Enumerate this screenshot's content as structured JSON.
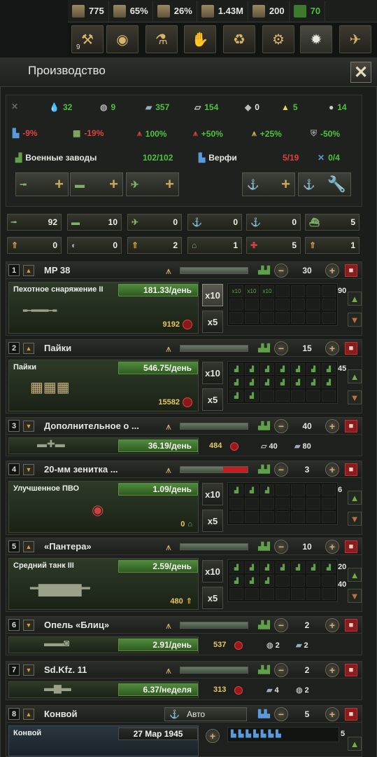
{
  "topbar": {
    "political_power": "775",
    "stability": "65%",
    "war_support": "26%",
    "manpower": "1.43M",
    "factories": "200",
    "convoys": "70"
  },
  "tabs": {
    "decisions_count": "9",
    "icons": [
      "hammer-icon",
      "eye-icon",
      "research-icon",
      "handshake-icon",
      "recycle-icon",
      "construction-icon",
      "gear-icon",
      "plane-icon"
    ]
  },
  "panel": {
    "title": "Производство",
    "close": "✕"
  },
  "resources": {
    "oil": "32",
    "rubber": "9",
    "steel": "357",
    "aluminium": "154",
    "tungsten": "0",
    "chromium": "5",
    "other": "14"
  },
  "modifiers": {
    "m1": "-9%",
    "m2": "-19%",
    "m3": "100%",
    "m4": "+50%",
    "m5": "+25%",
    "m6": "-50%"
  },
  "factories": {
    "mil_label": "Военные заводы",
    "mil_value": "102/102",
    "dock_label": "Верфи",
    "dock_value": "5/19",
    "dock_extra": "0/4"
  },
  "counts_row1": [
    "92",
    "10",
    "0",
    "0",
    "0",
    "5"
  ],
  "counts_row2": [
    "0",
    "0",
    "2",
    "1",
    "5",
    "1"
  ],
  "lines": [
    {
      "num": "1",
      "name": "MP 38",
      "count": "30",
      "card": "Пехотное снаряжение II",
      "rate": "181.33/день",
      "stock": "9192",
      "x10": "x10",
      "x5": "x5",
      "side": "90",
      "cells": [
        "x10",
        "x10",
        "x10"
      ]
    },
    {
      "num": "2",
      "name": "Пайки",
      "count": "15",
      "card": "Пайки",
      "rate": "546.75/день",
      "stock": "15582",
      "x10": "x10",
      "x5": "x5",
      "side": "45"
    },
    {
      "num": "3",
      "name": "Дополнительное о ...",
      "count": "40",
      "rate": "36.19/день",
      "stock": "484",
      "n1": "40",
      "n2": "80"
    },
    {
      "num": "4",
      "name": "20-мм зенитка ...",
      "count": "3",
      "card": "Улучшенное ПВО",
      "rate": "1.09/день",
      "stock": "0",
      "x10": "x10",
      "x5": "x5",
      "side": "6"
    },
    {
      "num": "5",
      "name": "«Пантера»",
      "count": "10",
      "card": "Средний танк III",
      "rate": "2.59/день",
      "stock": "480",
      "x10": "x10",
      "x5": "x5",
      "side1": "20",
      "side2": "40"
    },
    {
      "num": "6",
      "name": "Опель «Блиц»",
      "count": "2",
      "rate": "2.91/день",
      "stock": "537",
      "n1": "2",
      "n2": "2"
    },
    {
      "num": "7",
      "name": "Sd.Kfz. 11",
      "count": "2",
      "rate": "6.37/неделя",
      "stock": "313",
      "n1": "4",
      "n2": "2"
    },
    {
      "num": "8",
      "name": "Конвой",
      "count": "5",
      "auto": "Авто",
      "card": "Конвой",
      "date": "27 Мар 1945",
      "side": "5"
    }
  ]
}
